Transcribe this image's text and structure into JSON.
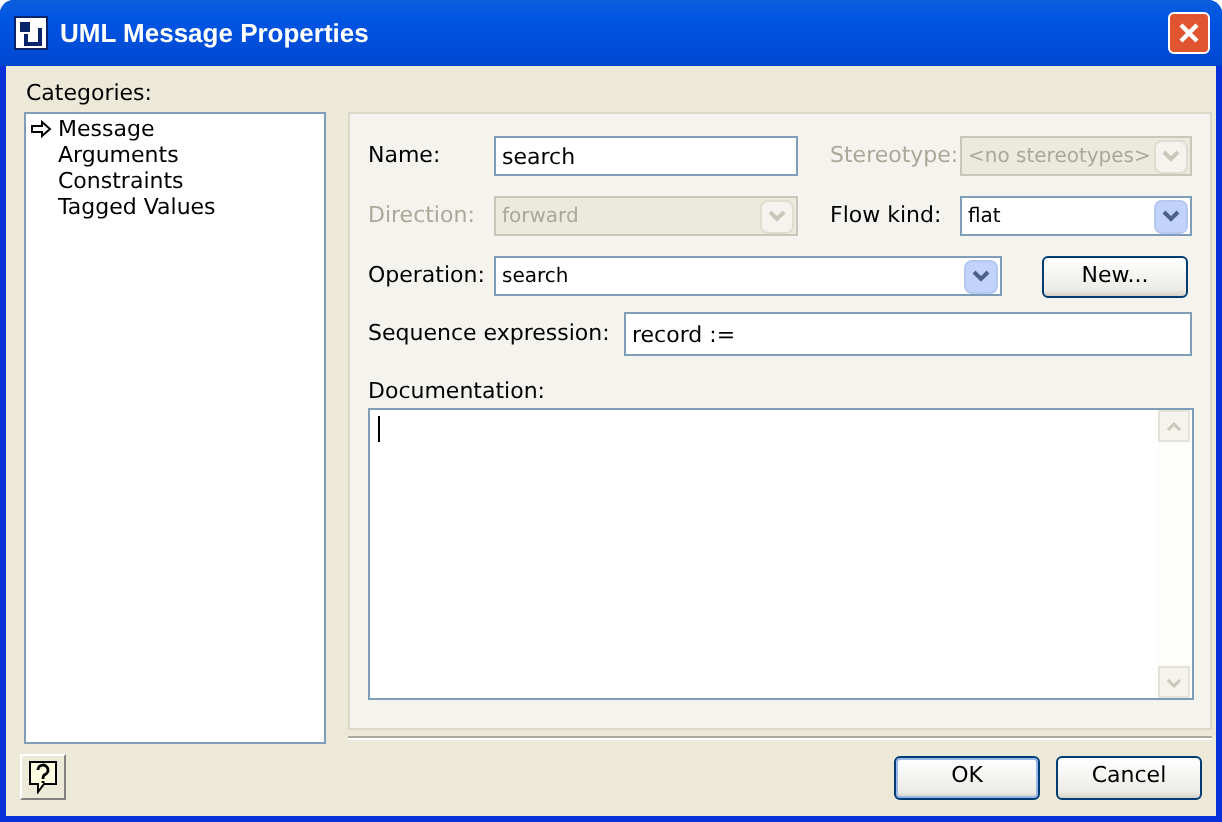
{
  "window": {
    "title": "UML Message Properties"
  },
  "categories": {
    "label": "Categories:",
    "items": [
      {
        "label": "Message",
        "selected": true
      },
      {
        "label": "Arguments",
        "selected": false
      },
      {
        "label": "Constraints",
        "selected": false
      },
      {
        "label": "Tagged Values",
        "selected": false
      }
    ]
  },
  "form": {
    "name": {
      "label": "Name:",
      "value": "search",
      "disabled": false
    },
    "stereotype": {
      "label": "Stereotype:",
      "value": "<no stereotypes>",
      "disabled": true
    },
    "direction": {
      "label": "Direction:",
      "value": "forward",
      "disabled": true
    },
    "flow_kind": {
      "label": "Flow kind:",
      "value": "flat",
      "disabled": false
    },
    "operation": {
      "label": "Operation:",
      "value": "search",
      "disabled": false
    },
    "new_button": "New...",
    "sequence_expression": {
      "label": "Sequence expression:",
      "value": "record :=",
      "disabled": false
    },
    "documentation": {
      "label": "Documentation:"
    }
  },
  "buttons": [
    "OK",
    "Cancel"
  ]
}
